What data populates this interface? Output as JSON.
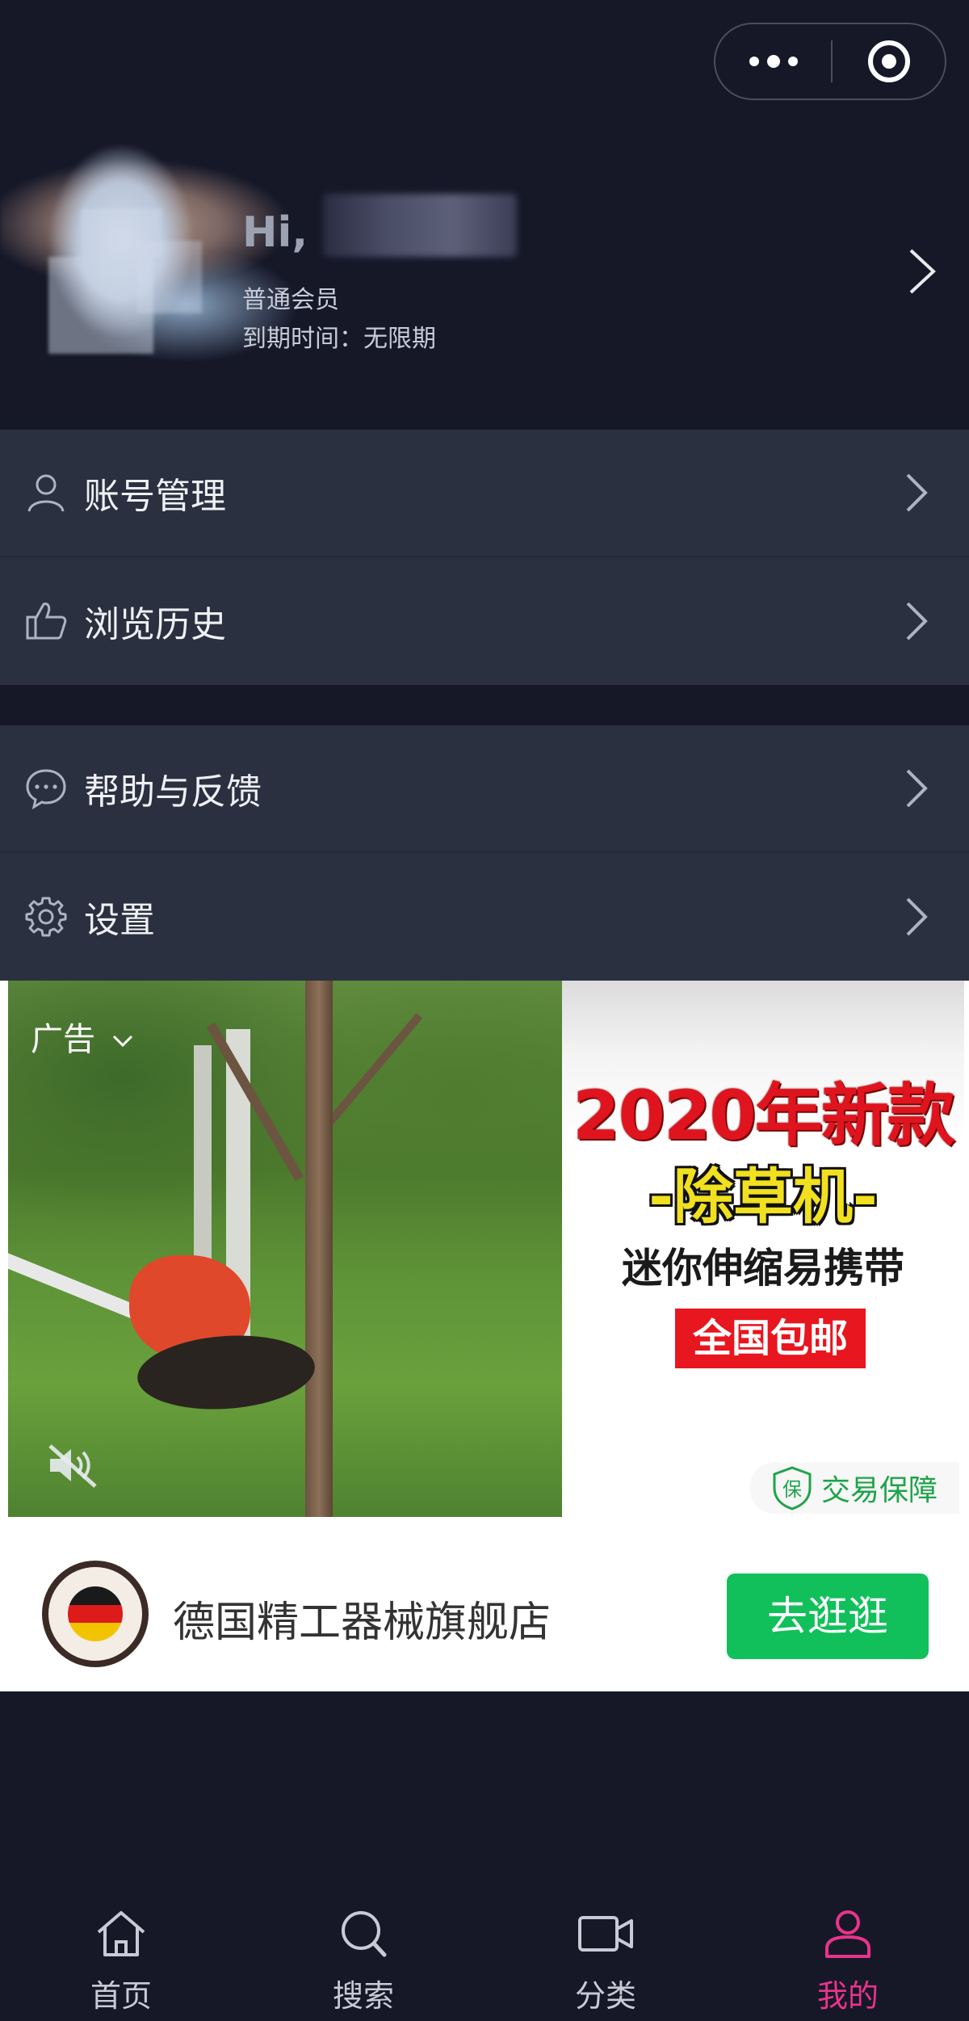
{
  "capsule": {
    "more_icon": "more-dots-icon",
    "close_icon": "target-circle-icon"
  },
  "profile": {
    "greeting": "Hi,",
    "member_level": "普通会员",
    "expire_text": "到期时间：无限期"
  },
  "menu": {
    "group1": [
      {
        "label": "账号管理",
        "icon": "user-icon"
      },
      {
        "label": "浏览历史",
        "icon": "thumbs-up-icon"
      }
    ],
    "group2": [
      {
        "label": "帮助与反馈",
        "icon": "chat-bubble-icon"
      },
      {
        "label": "设置",
        "icon": "gear-icon"
      }
    ]
  },
  "ad": {
    "label": "广告",
    "headline": "2020年新款",
    "product": "-除草机-",
    "subtitle": "迷你伸缩易携带",
    "badge": "全国包邮",
    "guarantee_mark": "保",
    "guarantee": "交易保障",
    "store_name": "德国精工器械旗舰店",
    "cta": "去逛逛",
    "colors": {
      "headline": "#e0141e",
      "product": "#f0e020",
      "cta": "#11c05a"
    }
  },
  "tabbar": {
    "items": [
      {
        "label": "首页",
        "icon": "home-icon"
      },
      {
        "label": "搜索",
        "icon": "search-icon"
      },
      {
        "label": "分类",
        "icon": "video-camera-icon"
      },
      {
        "label": "我的",
        "icon": "person-icon",
        "active": true
      }
    ],
    "active_color": "#e8348a"
  }
}
